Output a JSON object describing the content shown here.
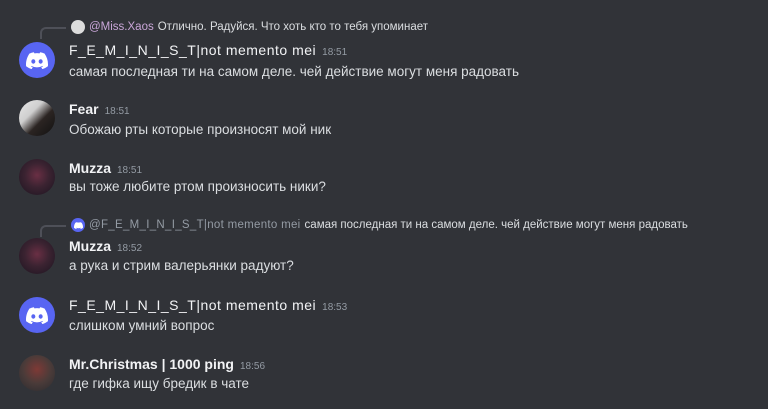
{
  "messages": [
    {
      "reply": {
        "name": "@Miss.Xaos",
        "text": "Отлично. Радуйся. Что хоть кто то тебя упоминает"
      },
      "author": "F_E_M_I_N_I_S_T|not memento mei",
      "time": "18:51",
      "text": "самая последная ти на самом деле. чей действие могут меня радовать",
      "avatar_icon": "discord-logo-icon"
    },
    {
      "author": "Fear",
      "time": "18:51",
      "text": "Обожаю рты которые произносят мой ник",
      "avatar_icon": "user-avatar"
    },
    {
      "author": "Muzza",
      "time": "18:51",
      "text": "вы тоже любите ртом произносить ники?",
      "avatar_icon": "user-avatar"
    },
    {
      "reply": {
        "name": "@F_E_M_I_N_I_S_T|not memento mei",
        "text": "самая последная ти на самом деле. чей действие могут меня радовать"
      },
      "author": "Muzza",
      "time": "18:52",
      "text": "а рука и стрим валерьянки радуют?",
      "avatar_icon": "user-avatar"
    },
    {
      "author": "F_E_M_I_N_I_S_T|not memento mei",
      "time": "18:53",
      "text": "слишком умний вопрос",
      "avatar_icon": "discord-logo-icon"
    },
    {
      "author": "Mr.Christmas | 1000 ping",
      "time": "18:56",
      "text": "где гифка ищу бредик в чате",
      "avatar_icon": "user-avatar"
    }
  ],
  "colors": {
    "background": "#313338",
    "discord_blurple": "#5865f2",
    "timestamp": "#949ba4"
  }
}
